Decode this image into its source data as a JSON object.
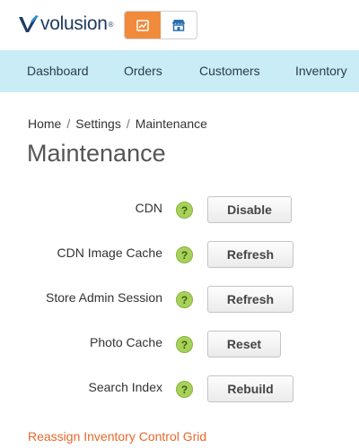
{
  "brand": {
    "name": "volusion",
    "reg": "®"
  },
  "view_toggle": {
    "active": "dashboard-view",
    "colors": {
      "active_bg": "#f28a3c"
    }
  },
  "nav": {
    "items": [
      {
        "label": "Dashboard"
      },
      {
        "label": "Orders"
      },
      {
        "label": "Customers"
      },
      {
        "label": "Inventory"
      }
    ]
  },
  "breadcrumb": {
    "items": [
      "Home",
      "Settings",
      "Maintenance"
    ],
    "separator": "/"
  },
  "page": {
    "title": "Maintenance"
  },
  "maintenance": {
    "help_glyph": "?",
    "rows": [
      {
        "label": "CDN",
        "button": "Disable"
      },
      {
        "label": "CDN Image Cache",
        "button": "Refresh"
      },
      {
        "label": "Store Admin Session",
        "button": "Refresh"
      },
      {
        "label": "Photo Cache",
        "button": "Reset"
      },
      {
        "label": "Search Index",
        "button": "Rebuild"
      }
    ]
  },
  "links": {
    "reassign": "Reassign Inventory Control Grid"
  },
  "colors": {
    "nav_bg": "#c9ecf7",
    "accent": "#f28a3c",
    "link": "#e8682a",
    "help": "#a8d15a"
  }
}
